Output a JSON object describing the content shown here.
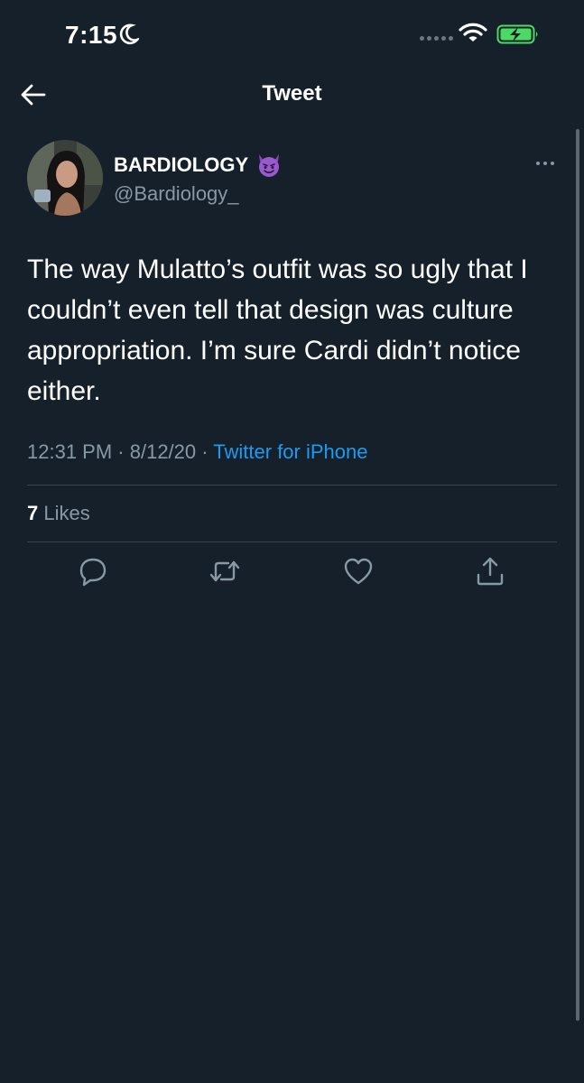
{
  "status_bar": {
    "time": "7:15"
  },
  "nav": {
    "title": "Tweet"
  },
  "tweet": {
    "display_name": "BARDIOLOGY",
    "handle": "@Bardiology_",
    "text": "The way Mulatto’s outfit was so ugly that I couldn’t even tell that design was culture appropriation. I’m sure Cardi didn’t notice either.",
    "time": "12:31 PM",
    "sep1": " · ",
    "date": "8/12/20",
    "sep2": " · ",
    "source": "Twitter for iPhone",
    "likes_count": "7",
    "likes_label": "Likes"
  },
  "icons": {
    "back": "arrow-left-icon",
    "name_emoji": "smiling-imp-emoji-icon",
    "more": "more-horizontal-icon",
    "reply": "reply-icon",
    "retweet": "retweet-icon",
    "like": "heart-icon",
    "share": "share-icon"
  },
  "colors": {
    "background": "#15202b",
    "secondary_text": "#8899a6",
    "link": "#1d9bf0",
    "divider": "#38444d",
    "battery_fill": "#4cd964"
  }
}
